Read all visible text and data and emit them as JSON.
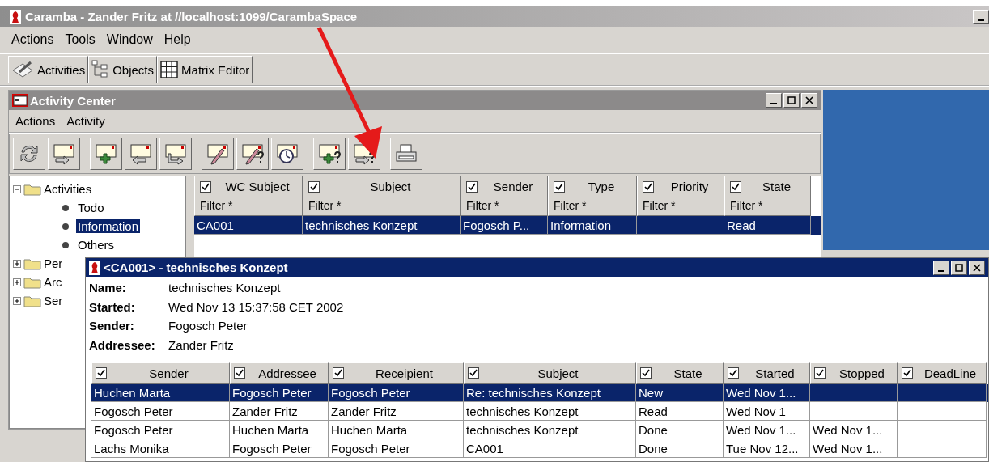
{
  "window": {
    "title": "Caramba - Zander Fritz at //localhost:1099/CarambaSpace",
    "menu": [
      "Actions",
      "Tools",
      "Window",
      "Help"
    ],
    "toolbar": [
      {
        "label": "Activities",
        "kind": "activities"
      },
      {
        "label": "Objects",
        "kind": "objects"
      },
      {
        "label": "Matrix Editor",
        "kind": "matrix"
      }
    ]
  },
  "activity_center": {
    "title": "Activity Center",
    "menu": [
      "Actions",
      "Activity"
    ],
    "tree": [
      {
        "label": "Activities",
        "expanded": true,
        "children": [
          {
            "label": "Todo",
            "selected": false
          },
          {
            "label": "Information",
            "selected": true
          },
          {
            "label": "Others",
            "selected": false
          }
        ]
      },
      {
        "label": "Per",
        "expanded": false
      },
      {
        "label": "Arc",
        "expanded": false
      },
      {
        "label": "Ser",
        "expanded": false
      }
    ],
    "table": {
      "columns": [
        {
          "label": "WC Subject",
          "checked": true,
          "filter": "Filter *"
        },
        {
          "label": "Subject",
          "checked": true,
          "filter": "Filter *"
        },
        {
          "label": "Sender",
          "checked": true,
          "filter": "Filter *"
        },
        {
          "label": "Type",
          "checked": true,
          "filter": "Filter *"
        },
        {
          "label": "Priority",
          "checked": true,
          "filter": "Filter *"
        },
        {
          "label": "State",
          "checked": true,
          "filter": "Filter *"
        }
      ],
      "rows": [
        {
          "selected": true,
          "cells": [
            "CA001",
            "technisches Konzept",
            "Fogosch P...",
            "Information",
            null,
            "Read"
          ]
        }
      ]
    }
  },
  "detail_window": {
    "title": "<CA001> - technisches Konzept",
    "fields": [
      {
        "label": "Name:",
        "value": "technisches Konzept"
      },
      {
        "label": "Started:",
        "value": "Wed Nov 13 15:37:58 CET 2002"
      },
      {
        "label": "Sender:",
        "value": "Fogosch Peter"
      },
      {
        "label": "Addressee:",
        "value": "Zander Fritz"
      }
    ],
    "table": {
      "columns": [
        {
          "label": "Sender",
          "checked": true
        },
        {
          "label": "Addressee",
          "checked": true
        },
        {
          "label": "Receipient",
          "checked": true
        },
        {
          "label": "Subject",
          "checked": true
        },
        {
          "label": "State",
          "checked": true
        },
        {
          "label": "Started",
          "checked": true
        },
        {
          "label": "Stopped",
          "checked": true
        },
        {
          "label": "DeadLine",
          "checked": true
        }
      ],
      "rows": [
        {
          "selected": true,
          "cells": [
            "Huchen Marta",
            "Fogosch Peter",
            "Fogosch Peter",
            "Re: technisches Konzept",
            "New",
            "Wed Nov 1...",
            null,
            null
          ]
        },
        {
          "selected": false,
          "cells": [
            "Fogosch Peter",
            "Zander Fritz",
            "Zander Fritz",
            "technisches Konzept",
            "Read",
            "Wed Nov 1",
            null,
            null
          ]
        },
        {
          "selected": false,
          "cells": [
            "Fogosch Peter",
            "Huchen Marta",
            "Huchen Marta",
            "technisches Konzept",
            "Done",
            "Wed Nov 1...",
            "Wed Nov 1...",
            null
          ]
        },
        {
          "selected": false,
          "cells": [
            "Lachs Monika",
            "Fogosch Peter",
            "Fogosch Peter",
            "CA001",
            "Done",
            "Tue Nov 12...",
            "Wed Nov 1...",
            null
          ]
        }
      ]
    }
  }
}
